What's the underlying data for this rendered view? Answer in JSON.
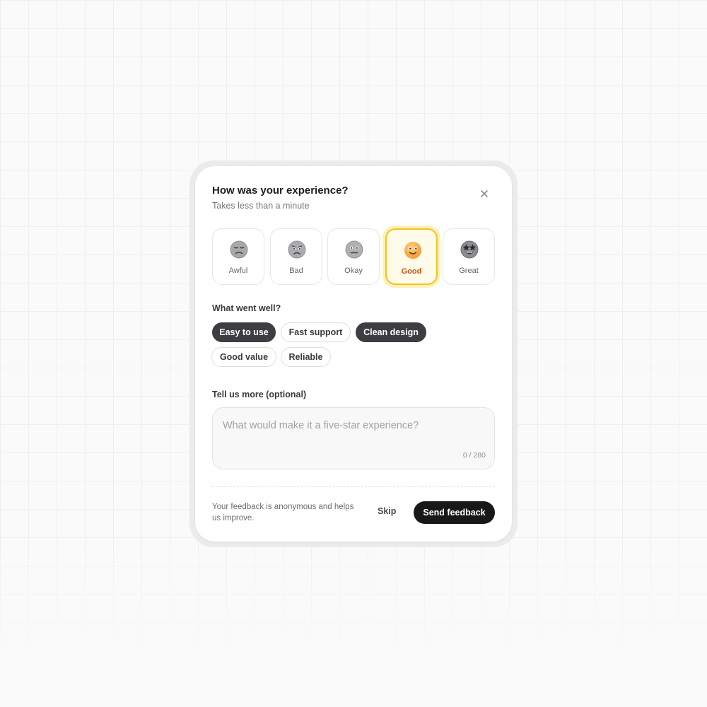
{
  "dialog": {
    "title": "How was your experience?",
    "subtitle": "Takes less than a minute",
    "close_icon": "close-icon"
  },
  "ratings": [
    {
      "label": "Awful",
      "icon": "awful-face-icon",
      "selected": false
    },
    {
      "label": "Bad",
      "icon": "bad-face-icon",
      "selected": false
    },
    {
      "label": "Okay",
      "icon": "okay-face-icon",
      "selected": false
    },
    {
      "label": "Good",
      "icon": "good-face-icon",
      "selected": true
    },
    {
      "label": "Great",
      "icon": "great-face-icon",
      "selected": false
    }
  ],
  "well": {
    "label": "What went well?",
    "chips": [
      {
        "label": "Easy to use",
        "selected": true
      },
      {
        "label": "Fast support",
        "selected": false
      },
      {
        "label": "Clean design",
        "selected": true
      },
      {
        "label": "Good value",
        "selected": false
      },
      {
        "label": "Reliable",
        "selected": false
      }
    ]
  },
  "more": {
    "label": "Tell us more (optional)",
    "placeholder": "What would make it a five-star experience?",
    "value": "",
    "counter": "0 / 280"
  },
  "footer": {
    "note": "Your feedback is anonymous and helps us improve.",
    "skip_label": "Skip",
    "send_label": "Send feedback"
  },
  "colors": {
    "selected_border": "#f3c21d",
    "selected_text": "#c2560c",
    "chip_active_bg": "#3d3d42",
    "primary_button_bg": "#18181b"
  }
}
